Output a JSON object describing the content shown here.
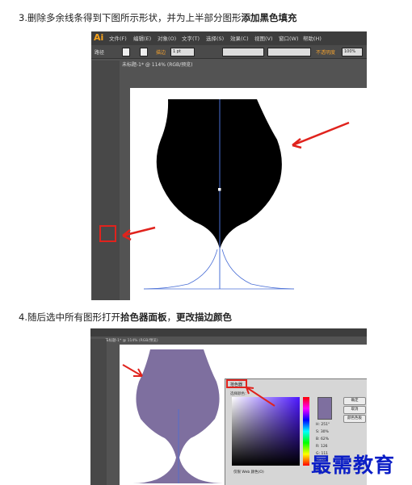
{
  "step3": {
    "prefix": "3.删除多余线条得到下图所示形状，并为上半部分图形",
    "highlight": "添加黑色填充"
  },
  "step4": {
    "prefix": "4.随后选中所有图形打开",
    "highlight1": "拾色器面板",
    "middle": "，",
    "highlight2": "更改描边颜色"
  },
  "shot1": {
    "app_logo": "Ai",
    "menus": [
      "文件(F)",
      "编辑(E)",
      "对象(O)",
      "文字(T)",
      "选择(S)",
      "效果(C)",
      "视图(V)",
      "窗口(W)",
      "帮助(H)"
    ],
    "control": {
      "selection_label": "路径",
      "stroke_label": "描边",
      "stroke_weight": "1 pt",
      "style_label": "不透明度",
      "opacity": "100%"
    },
    "doc_tab": "未标题-1* @ 114% (RGB/预览)",
    "fill_color": "#000000",
    "stroke_color": "#4a6fd6"
  },
  "shot2": {
    "doc_tab": "未标题-1* @ 114% (RGB/预览)",
    "shape_fill_color": "#7e6f9f",
    "picker": {
      "title": "拾色器",
      "subtitle": "选择颜色：",
      "buttons": [
        "确定",
        "取消",
        "颜色色板"
      ],
      "fields": [
        {
          "label": "H:",
          "value": "251°"
        },
        {
          "label": "S:",
          "value": "30%"
        },
        {
          "label": "B:",
          "value": "62%"
        },
        {
          "label": "R:",
          "value": "126"
        },
        {
          "label": "G:",
          "value": "111"
        },
        {
          "label": "B:",
          "value": "159"
        },
        {
          "label": "#",
          "value": "7E6F9F"
        }
      ],
      "only_web_label": "仅限 Web 颜色(O)"
    }
  },
  "watermark": "最需教育"
}
